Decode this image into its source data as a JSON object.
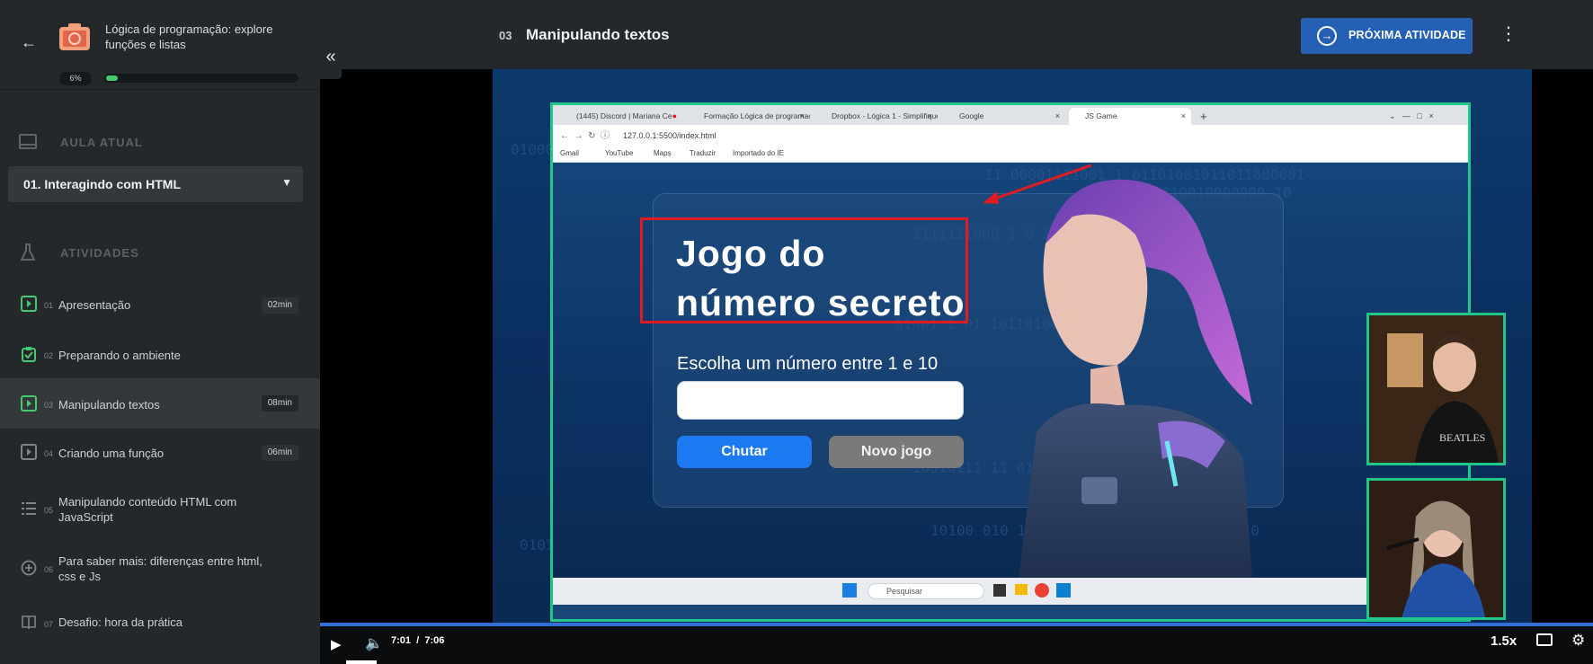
{
  "course": {
    "title": "Lógica de programação: explore funções e listas",
    "progress_label": "6%",
    "progress_value": 0.06
  },
  "sidebar": {
    "current_section_label": "AULA ATUAL",
    "current_lesson": "01. Interagindo com HTML",
    "activities_label": "ATIVIDADES",
    "activities": [
      {
        "num": "01",
        "label": "Apresentação",
        "duration": "02min",
        "icon": "video-icon"
      },
      {
        "num": "02",
        "label": "Preparando o ambiente",
        "duration": "",
        "icon": "clipboard-icon"
      },
      {
        "num": "03",
        "label": "Manipulando textos",
        "duration": "08min",
        "icon": "video-icon"
      },
      {
        "num": "04",
        "label": "Criando uma função",
        "duration": "06min",
        "icon": "video-icon"
      },
      {
        "num": "05",
        "label": "Manipulando conteúdo HTML com JavaScript",
        "duration": "",
        "icon": "list-icon"
      },
      {
        "num": "06",
        "label": "Para saber mais: diferenças entre html, css e Js",
        "duration": "",
        "icon": "plus-circle-icon"
      },
      {
        "num": "07",
        "label": "Desafio: hora da prática",
        "duration": "",
        "icon": "book-icon"
      }
    ]
  },
  "header": {
    "lesson_number": "03",
    "lesson_title": "Manipulando textos",
    "next_label": "PRÓXIMA ATIVIDADE"
  },
  "browser": {
    "tabs": [
      "(1445) Discord | Mariana Ce",
      "Formação Lógica de programaçã",
      "Dropbox - Lógica 1 - Simplifique",
      "Google",
      "JS Game"
    ],
    "url": "127.0.0.1:5500/index.html",
    "bookmarks": [
      "Gmail",
      "YouTube",
      "Maps",
      "Traduzir",
      "Importado do IE"
    ],
    "taskbar_search": "Pesquisar"
  },
  "game": {
    "title_line1": "Jogo do",
    "title_line2": "número secreto",
    "prompt": "Escolha um número entre 1 e 10",
    "input_value": "",
    "btn_guess": "Chutar",
    "btn_new": "Novo jogo"
  },
  "player": {
    "time_current": "7:01",
    "time_separator": "/",
    "time_total": "7:06",
    "speed": "1.5x",
    "progress_value": 0.988
  },
  "colors": {
    "accent_green": "#21c68b",
    "brand_blue": "#2461b4",
    "highlight_red": "#e11b22"
  }
}
